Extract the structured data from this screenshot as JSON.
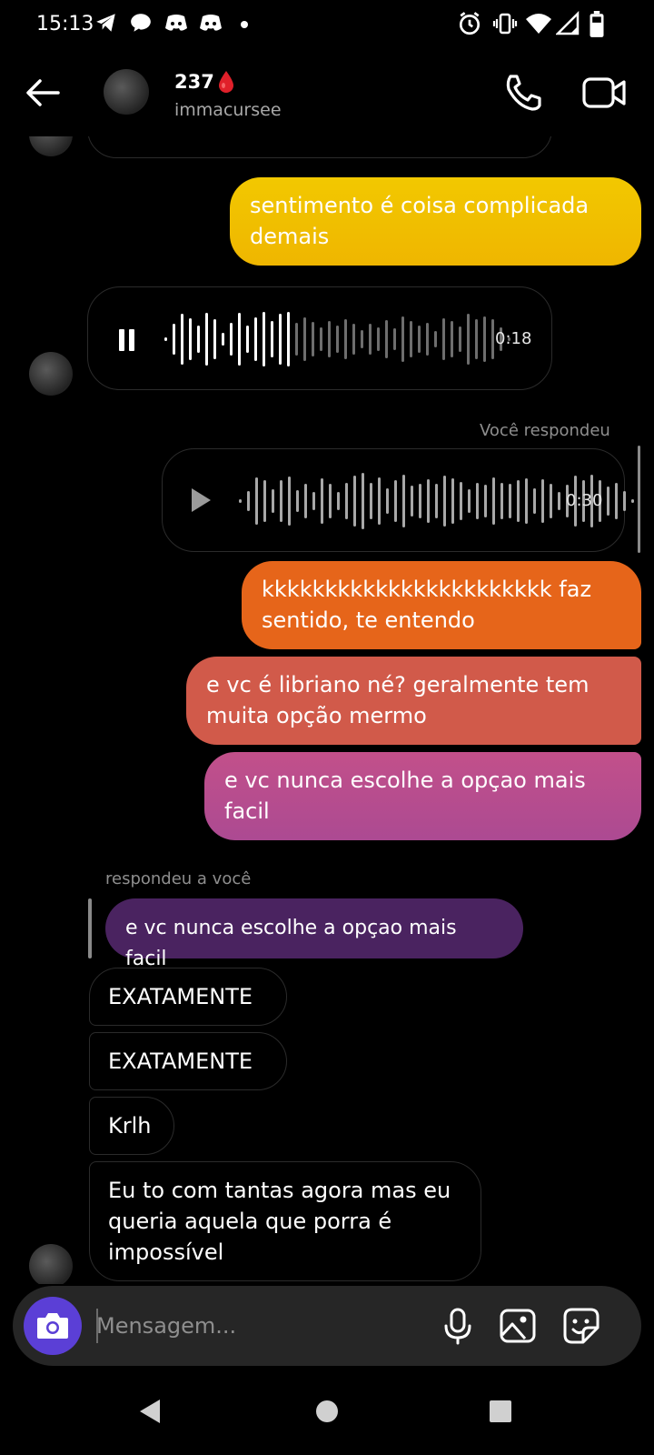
{
  "status_bar": {
    "time": "15:13",
    "left_icons": [
      "telegram-icon",
      "chat-bubble-icon",
      "discord-icon",
      "discord-icon",
      "dot-icon"
    ],
    "right_icons": [
      "alarm-icon",
      "vibrate-icon",
      "wifi-icon",
      "signal-icon",
      "battery-icon"
    ]
  },
  "header": {
    "name": "237",
    "name_emoji": "drop-of-blood-icon",
    "username": "immacursee",
    "icons": [
      "back-arrow-icon",
      "phone-icon",
      "video-camera-icon"
    ]
  },
  "messages": {
    "m1": "sentimento é coisa complicada demais",
    "voice_in_duration": "0:18",
    "replied_label": "Você respondeu",
    "voice_out_duration": "0:30",
    "m2": "kkkkkkkkkkkkkkkkkkkkkkk faz sentido, te entendo",
    "m3": "e vc é libriano né? geralmente tem muita opção mermo",
    "m4": "e vc nunca escolhe a opçao mais facil",
    "reply_label": "respondeu a você",
    "reply_quote": "e vc nunca escolhe a opçao mais facil",
    "m5": "EXATAMENTE",
    "m6": "EXATAMENTE",
    "m7": "Krlh",
    "m8": "Eu to com tantas agora mas eu queria aquela que porra é impossível"
  },
  "composer": {
    "placeholder": "Mensagem...",
    "icons": [
      "camera-icon",
      "microphone-icon",
      "gallery-icon",
      "sticker-icon"
    ]
  },
  "nav": {
    "icons": [
      "back-nav-icon",
      "home-nav-icon",
      "recents-nav-icon"
    ]
  },
  "colors": {
    "gradient_top": "#f2c800",
    "gradient_mid": "#e8621a",
    "gradient_bottom": "#b04a8a",
    "quote_bubble": "#4a2360",
    "camera_button": "#5b3fd6"
  }
}
